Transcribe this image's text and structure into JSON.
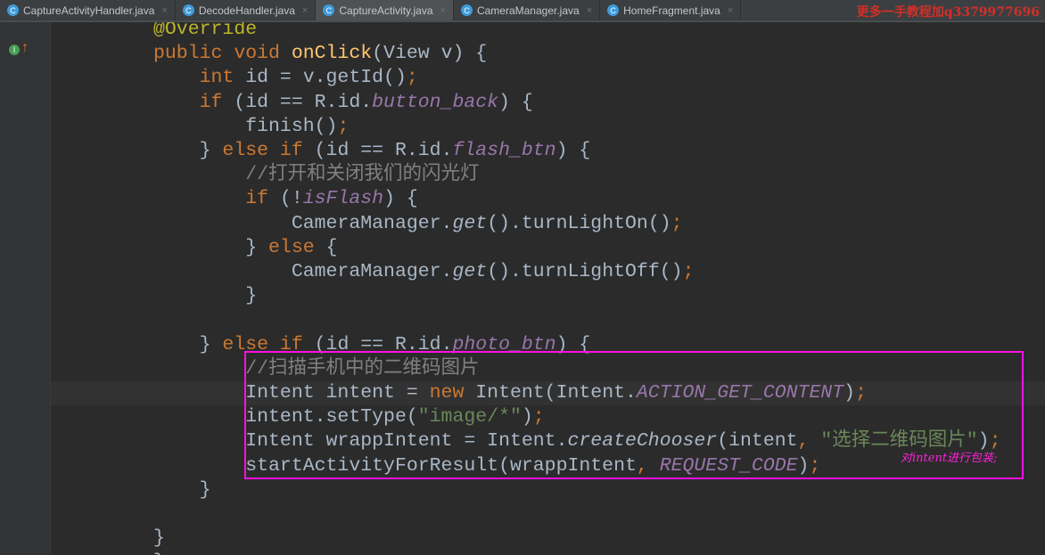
{
  "tabs": [
    {
      "label": "CaptureActivityHandler.java",
      "active": false
    },
    {
      "label": "DecodeHandler.java",
      "active": false
    },
    {
      "label": "CaptureActivity.java",
      "active": true
    },
    {
      "label": "CameraManager.java",
      "active": false
    },
    {
      "label": "HomeFragment.java",
      "active": false
    }
  ],
  "tab_icon": "C",
  "tab_close": "×",
  "watermark": "更多一手教程加q3379977696",
  "annotation": "对intent进行包装;",
  "code_lines": [
    [
      [
        "@Override",
        "ann"
      ]
    ],
    [
      [
        "public void ",
        "kw"
      ],
      [
        "onClick",
        "fn"
      ],
      [
        "(View v) {",
        ""
      ]
    ],
    [
      [
        "    int ",
        "kw"
      ],
      [
        "id = v.getId()",
        ""
      ],
      [
        ";",
        "kw"
      ]
    ],
    [
      [
        "    if ",
        "kw"
      ],
      [
        "(id == R.id.",
        ""
      ],
      [
        "button_back",
        "fld"
      ],
      [
        ") {",
        ""
      ]
    ],
    [
      [
        "        finish()",
        ""
      ],
      [
        ";",
        "kw"
      ]
    ],
    [
      [
        "    } ",
        ""
      ],
      [
        "else if ",
        "kw"
      ],
      [
        "(id == R.id.",
        ""
      ],
      [
        "flash_btn",
        "fld"
      ],
      [
        ") {",
        ""
      ]
    ],
    [
      [
        "        //打开和关闭我们的闪光灯",
        "cmt"
      ]
    ],
    [
      [
        "        if ",
        "kw"
      ],
      [
        "(!",
        ""
      ],
      [
        "isFlash",
        "fld"
      ],
      [
        ") {",
        ""
      ]
    ],
    [
      [
        "            CameraManager.",
        ""
      ],
      [
        "get",
        "mth"
      ],
      [
        "().turnLightOn()",
        ""
      ],
      [
        ";",
        "kw"
      ]
    ],
    [
      [
        "        } ",
        ""
      ],
      [
        "else ",
        "kw"
      ],
      [
        "{",
        ""
      ]
    ],
    [
      [
        "            CameraManager.",
        ""
      ],
      [
        "get",
        "mth"
      ],
      [
        "().turnLightOff()",
        ""
      ],
      [
        ";",
        "kw"
      ]
    ],
    [
      [
        "        }",
        ""
      ]
    ],
    [],
    [
      [
        "    } ",
        ""
      ],
      [
        "else if ",
        "kw"
      ],
      [
        "(id == R.id.",
        ""
      ],
      [
        "photo_btn",
        "fld"
      ],
      [
        ") {",
        ""
      ]
    ],
    [
      [
        "        //扫描手机中的二维码图片",
        "cmt"
      ]
    ],
    [
      [
        "        Intent intent = ",
        ""
      ],
      [
        "new ",
        "kw"
      ],
      [
        "Intent(Intent.",
        ""
      ],
      [
        "ACTION_GET_CONTENT",
        "fld"
      ],
      [
        ")",
        ""
      ],
      [
        ";",
        "kw"
      ]
    ],
    [
      [
        "        intent.setType(",
        ""
      ],
      [
        "\"image/*\"",
        "str"
      ],
      [
        ")",
        ""
      ],
      [
        ";",
        "kw"
      ]
    ],
    [
      [
        "        Intent wrappIntent = Intent.",
        ""
      ],
      [
        "createChooser",
        "mth"
      ],
      [
        "(intent",
        ""
      ],
      [
        ", ",
        "kw"
      ],
      [
        "\"选择二维码图片\"",
        "str"
      ],
      [
        ")",
        ""
      ],
      [
        ";",
        "kw"
      ]
    ],
    [
      [
        "        startActivityForResult(wrappIntent",
        ""
      ],
      [
        ", ",
        "kw"
      ],
      [
        "REQUEST_CODE",
        "fld"
      ],
      [
        ")",
        ""
      ],
      [
        ";",
        "kw"
      ]
    ],
    [
      [
        "    }",
        ""
      ]
    ],
    [],
    [
      [
        "}",
        ""
      ]
    ],
    [
      [
        "};",
        ""
      ]
    ]
  ],
  "current_line": 15
}
